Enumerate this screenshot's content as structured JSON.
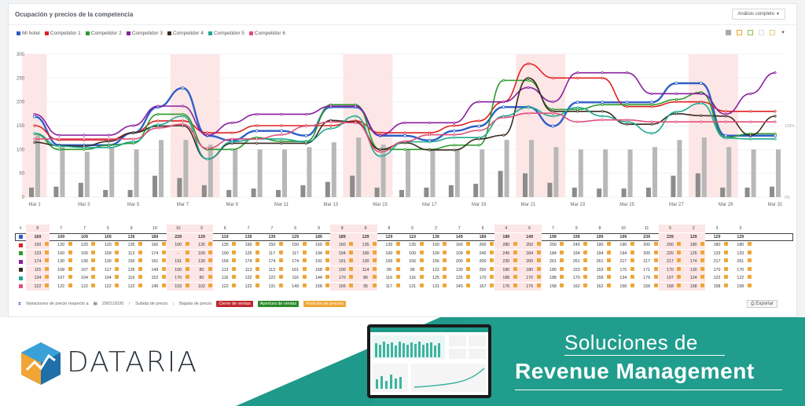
{
  "panel": {
    "title": "Ocupación y precios de la competencia",
    "analysis_button": "Análisis completo"
  },
  "legend": [
    {
      "name": "Mi hotel",
      "color": "#2e5fc8"
    },
    {
      "name": "Competidor 1",
      "color": "#e02020"
    },
    {
      "name": "Competidor 2",
      "color": "#2a9a2a"
    },
    {
      "name": "Competidor 3",
      "color": "#8a1fa0"
    },
    {
      "name": "Competidor 4",
      "color": "#3a2a20"
    },
    {
      "name": "Competidor 5",
      "color": "#20a890"
    },
    {
      "name": "Competidor 6",
      "color": "#e0507a"
    }
  ],
  "chart_data": {
    "type": "line",
    "x": [
      "Mar 1",
      "Mar 2",
      "Mar 3",
      "Mar 4",
      "Mar 5",
      "Mar 6",
      "Mar 7",
      "Mar 8",
      "Mar 9",
      "Mar 10",
      "Mar 11",
      "Mar 12",
      "Mar 13",
      "Mar 14",
      "Mar 15",
      "Mar 16",
      "Mar 17",
      "Mar 18",
      "Mar 19",
      "Mar 20",
      "Mar 21",
      "Mar 22",
      "Mar 23",
      "Mar 24",
      "Mar 25",
      "Mar 26",
      "Mar 27",
      "Mar 28",
      "Mar 29",
      "Mar 30",
      "Mar 31"
    ],
    "x_tick_labels": [
      "Mar 1",
      "Mar 3",
      "Mar 5",
      "Mar 7",
      "Mar 9",
      "Mar 11",
      "Mar 13",
      "Mar 15",
      "Mar 17",
      "Mar 19",
      "Mar 21",
      "Mar 23",
      "Mar 25",
      "Mar 27",
      "Mar 29",
      "Mar 31"
    ],
    "y_tick_labels": [
      "0",
      "50",
      "100",
      "150",
      "200",
      "250",
      "300"
    ],
    "right_tick_labels": [
      "0%",
      "100%"
    ],
    "ylim": [
      0,
      300
    ],
    "weekend_index": [
      0,
      6,
      7,
      13,
      14,
      20,
      21,
      27,
      28
    ],
    "occupancy": [
      8,
      7,
      7,
      5,
      9,
      10,
      10,
      9,
      6,
      7,
      7,
      5,
      9,
      8,
      8,
      8,
      5,
      2,
      7,
      6,
      4,
      6,
      7,
      9,
      8,
      10,
      11,
      5,
      2,
      3,
      3
    ],
    "occupancy_dark": [
      20,
      22,
      30,
      15,
      15,
      45,
      40,
      25,
      15,
      18,
      15,
      25,
      32,
      45,
      20,
      15,
      20,
      25,
      28,
      55,
      50,
      30,
      20,
      18,
      18,
      20,
      45,
      50,
      20,
      20,
      22
    ],
    "occupancy_light": [
      130,
      110,
      95,
      105,
      100,
      120,
      120,
      110,
      100,
      100,
      100,
      105,
      115,
      125,
      110,
      100,
      100,
      100,
      100,
      120,
      120,
      105,
      100,
      100,
      100,
      105,
      120,
      125,
      105,
      100,
      100
    ],
    "series": [
      {
        "name": "Mi hotel",
        "color": "#2e5fc8",
        "values": [
          169,
          109,
          109,
          109,
          135,
          189,
          229,
          129,
          119,
          139,
          139,
          129,
          189,
          189,
          129,
          129,
          119,
          139,
          149,
          189,
          189,
          149,
          199,
          199,
          199,
          199,
          239,
          239,
          129,
          129,
          129
        ]
      },
      {
        "name": "Competidor 1",
        "color": "#e02020",
        "values": [
          150,
          120,
          120,
          120,
          135,
          160,
          160,
          135,
          135,
          150,
          150,
          150,
          150,
          160,
          135,
          135,
          135,
          150,
          160,
          200,
          280,
          250,
          250,
          250,
          190,
          190,
          200,
          200,
          180,
          180,
          180
        ]
      },
      {
        "name": "Competidor 2",
        "color": "#2a9a2a",
        "values": [
          133,
          100,
          100,
          109,
          113,
          174,
          174,
          100,
          100,
          125,
          117,
          117,
          194,
          194,
          100,
          100,
          100,
          109,
          109,
          245,
          245,
          184,
          184,
          194,
          194,
          194,
          205,
          220,
          125,
          133,
          133
        ]
      },
      {
        "name": "Competidor 3",
        "color": "#8a1fa0",
        "values": [
          174,
          130,
          130,
          130,
          150,
          191,
          191,
          130,
          156,
          174,
          174,
          174,
          191,
          191,
          130,
          156,
          156,
          156,
          200,
          200,
          230,
          200,
          261,
          261,
          261,
          217,
          217,
          217,
          174,
          217,
          261
        ]
      },
      {
        "name": "Competidor 4",
        "color": "#3a2a20",
        "values": [
          115,
          108,
          107,
          117,
          135,
          149,
          150,
          80,
          113,
          113,
          113,
          113,
          161,
          158,
          100,
          114,
          99,
          99,
          122,
          130,
          250,
          180,
          180,
          180,
          153,
          153,
          175,
          171,
          170,
          130,
          170
        ]
      },
      {
        "name": "Competidor 5",
        "color": "#20a890",
        "values": [
          134,
          107,
          104,
          104,
          116,
          152,
          170,
          80,
          116,
          122,
          122,
          116,
          144,
          170,
          86,
          116,
          116,
          125,
          125,
          170,
          188,
          170,
          188,
          170,
          158,
          134,
          179,
          197,
          124,
          122,
          122
        ]
      },
      {
        "name": "Competidor 6",
        "color": "#e0507a",
        "values": [
          122,
          122,
          122,
          122,
          122,
          145,
          153,
          102,
          122,
          122,
          131,
          149,
          158,
          156,
          95,
          117,
          131,
          131,
          140,
          167,
          176,
          176,
          158,
          162,
          162,
          158,
          158,
          158,
          158,
          158,
          158
        ]
      }
    ]
  },
  "grid": {
    "header_label": "#",
    "rows": [
      {
        "color": "#2e5fc8",
        "values": [
          "169",
          "109",
          "109",
          "109",
          "135",
          "189",
          "229",
          "129",
          "119",
          "139",
          "139",
          "129",
          "189",
          "189",
          "129",
          "129",
          "119",
          "139",
          "149",
          "189",
          "189",
          "149",
          "199",
          "199",
          "199",
          "199",
          "239",
          "239",
          "129",
          "129",
          "129"
        ]
      },
      {
        "color": "#e02020",
        "values": [
          "150",
          "120",
          "120",
          "120",
          "135",
          "160",
          "160",
          "135",
          "135",
          "150",
          "150",
          "150",
          "150",
          "160",
          "135",
          "135",
          "135",
          "150",
          "160",
          "200",
          "280",
          "250",
          "250",
          "240",
          "190",
          "190",
          "200",
          "200",
          "180",
          "180",
          "180"
        ]
      },
      {
        "color": "#2a9a2a",
        "values": [
          "133",
          "100",
          "100",
          "109",
          "113",
          "174",
          "-",
          "100",
          "100",
          "125",
          "117",
          "117",
          "194",
          "194",
          "100",
          "100",
          "100",
          "109",
          "109",
          "245",
          "245",
          "184",
          "184",
          "194",
          "194",
          "194",
          "205",
          "220",
          "125",
          "133",
          "133"
        ]
      },
      {
        "color": "#8a1fa0",
        "values": [
          "174",
          "130",
          "130",
          "130",
          "150",
          "191",
          "191",
          "130",
          "156",
          "174",
          "174",
          "174",
          "191",
          "191",
          "130",
          "156",
          "156",
          "156",
          "200",
          "200",
          "230",
          "200",
          "261",
          "261",
          "261",
          "217",
          "217",
          "217",
          "174",
          "217",
          "261"
        ]
      },
      {
        "color": "#3a2a20",
        "values": [
          "115",
          "108",
          "107",
          "117",
          "135",
          "149",
          "150",
          "80",
          "113",
          "113",
          "113",
          "161",
          "158",
          "100",
          "114",
          "99",
          "99",
          "122",
          "130",
          "250",
          "180",
          "180",
          "180",
          "153",
          "153",
          "175",
          "171",
          "170",
          "130",
          "170",
          "170"
        ]
      },
      {
        "color": "#20a890",
        "values": [
          "134",
          "107",
          "104",
          "104",
          "116",
          "152",
          "170",
          "80",
          "116",
          "122",
          "122",
          "116",
          "144",
          "170",
          "86",
          "116",
          "116",
          "125",
          "125",
          "170",
          "188",
          "170",
          "188",
          "170",
          "158",
          "134",
          "179",
          "197",
          "124",
          "122",
          "122"
        ]
      },
      {
        "color": "#e0507a",
        "values": [
          "122",
          "122",
          "122",
          "122",
          "122",
          "145",
          "153",
          "102",
          "122",
          "122",
          "131",
          "149",
          "158",
          "156",
          "95",
          "117",
          "131",
          "131",
          "140",
          "167",
          "176",
          "176",
          "158",
          "162",
          "162",
          "158",
          "158",
          "158",
          "158",
          "158",
          "158"
        ]
      }
    ]
  },
  "footnote": {
    "variations": "Variaciones de precio respecto a",
    "date": "29/01/2020",
    "price_up": "Subida de precio",
    "price_down": "Bajada de precio",
    "close_sales": "Cierre de ventas",
    "open_sales": "Apertura de ventas",
    "price_position": "Posición de precios"
  },
  "export_button": "Exportar",
  "banner": {
    "brand": "DATARIA",
    "headline_line1": "Soluciones de",
    "headline_line2": "Revenue Management",
    "teal_color": "#1f9a8a"
  }
}
